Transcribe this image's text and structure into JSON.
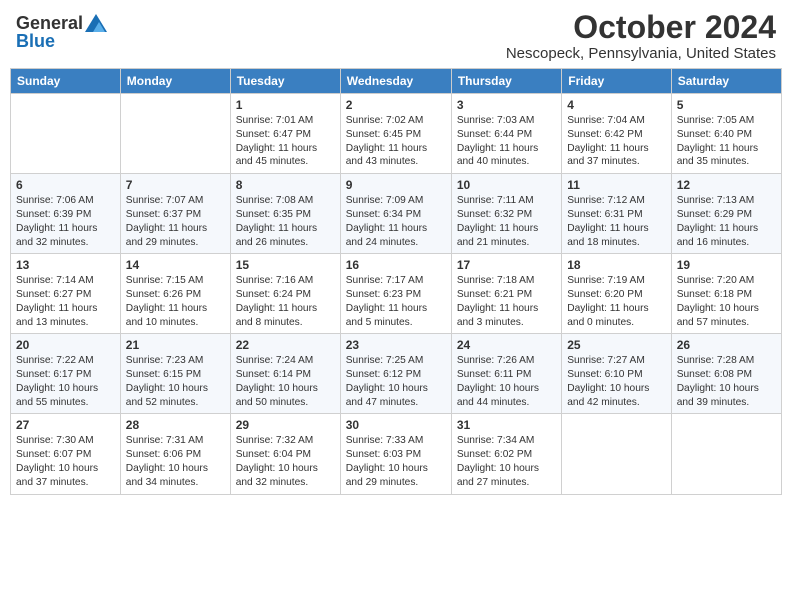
{
  "header": {
    "logo_general": "General",
    "logo_blue": "Blue",
    "title": "October 2024",
    "subtitle": "Nescopeck, Pennsylvania, United States"
  },
  "days_of_week": [
    "Sunday",
    "Monday",
    "Tuesday",
    "Wednesday",
    "Thursday",
    "Friday",
    "Saturday"
  ],
  "weeks": [
    [
      {
        "day": "",
        "content": ""
      },
      {
        "day": "",
        "content": ""
      },
      {
        "day": "1",
        "content": "Sunrise: 7:01 AM\nSunset: 6:47 PM\nDaylight: 11 hours and 45 minutes."
      },
      {
        "day": "2",
        "content": "Sunrise: 7:02 AM\nSunset: 6:45 PM\nDaylight: 11 hours and 43 minutes."
      },
      {
        "day": "3",
        "content": "Sunrise: 7:03 AM\nSunset: 6:44 PM\nDaylight: 11 hours and 40 minutes."
      },
      {
        "day": "4",
        "content": "Sunrise: 7:04 AM\nSunset: 6:42 PM\nDaylight: 11 hours and 37 minutes."
      },
      {
        "day": "5",
        "content": "Sunrise: 7:05 AM\nSunset: 6:40 PM\nDaylight: 11 hours and 35 minutes."
      }
    ],
    [
      {
        "day": "6",
        "content": "Sunrise: 7:06 AM\nSunset: 6:39 PM\nDaylight: 11 hours and 32 minutes."
      },
      {
        "day": "7",
        "content": "Sunrise: 7:07 AM\nSunset: 6:37 PM\nDaylight: 11 hours and 29 minutes."
      },
      {
        "day": "8",
        "content": "Sunrise: 7:08 AM\nSunset: 6:35 PM\nDaylight: 11 hours and 26 minutes."
      },
      {
        "day": "9",
        "content": "Sunrise: 7:09 AM\nSunset: 6:34 PM\nDaylight: 11 hours and 24 minutes."
      },
      {
        "day": "10",
        "content": "Sunrise: 7:11 AM\nSunset: 6:32 PM\nDaylight: 11 hours and 21 minutes."
      },
      {
        "day": "11",
        "content": "Sunrise: 7:12 AM\nSunset: 6:31 PM\nDaylight: 11 hours and 18 minutes."
      },
      {
        "day": "12",
        "content": "Sunrise: 7:13 AM\nSunset: 6:29 PM\nDaylight: 11 hours and 16 minutes."
      }
    ],
    [
      {
        "day": "13",
        "content": "Sunrise: 7:14 AM\nSunset: 6:27 PM\nDaylight: 11 hours and 13 minutes."
      },
      {
        "day": "14",
        "content": "Sunrise: 7:15 AM\nSunset: 6:26 PM\nDaylight: 11 hours and 10 minutes."
      },
      {
        "day": "15",
        "content": "Sunrise: 7:16 AM\nSunset: 6:24 PM\nDaylight: 11 hours and 8 minutes."
      },
      {
        "day": "16",
        "content": "Sunrise: 7:17 AM\nSunset: 6:23 PM\nDaylight: 11 hours and 5 minutes."
      },
      {
        "day": "17",
        "content": "Sunrise: 7:18 AM\nSunset: 6:21 PM\nDaylight: 11 hours and 3 minutes."
      },
      {
        "day": "18",
        "content": "Sunrise: 7:19 AM\nSunset: 6:20 PM\nDaylight: 11 hours and 0 minutes."
      },
      {
        "day": "19",
        "content": "Sunrise: 7:20 AM\nSunset: 6:18 PM\nDaylight: 10 hours and 57 minutes."
      }
    ],
    [
      {
        "day": "20",
        "content": "Sunrise: 7:22 AM\nSunset: 6:17 PM\nDaylight: 10 hours and 55 minutes."
      },
      {
        "day": "21",
        "content": "Sunrise: 7:23 AM\nSunset: 6:15 PM\nDaylight: 10 hours and 52 minutes."
      },
      {
        "day": "22",
        "content": "Sunrise: 7:24 AM\nSunset: 6:14 PM\nDaylight: 10 hours and 50 minutes."
      },
      {
        "day": "23",
        "content": "Sunrise: 7:25 AM\nSunset: 6:12 PM\nDaylight: 10 hours and 47 minutes."
      },
      {
        "day": "24",
        "content": "Sunrise: 7:26 AM\nSunset: 6:11 PM\nDaylight: 10 hours and 44 minutes."
      },
      {
        "day": "25",
        "content": "Sunrise: 7:27 AM\nSunset: 6:10 PM\nDaylight: 10 hours and 42 minutes."
      },
      {
        "day": "26",
        "content": "Sunrise: 7:28 AM\nSunset: 6:08 PM\nDaylight: 10 hours and 39 minutes."
      }
    ],
    [
      {
        "day": "27",
        "content": "Sunrise: 7:30 AM\nSunset: 6:07 PM\nDaylight: 10 hours and 37 minutes."
      },
      {
        "day": "28",
        "content": "Sunrise: 7:31 AM\nSunset: 6:06 PM\nDaylight: 10 hours and 34 minutes."
      },
      {
        "day": "29",
        "content": "Sunrise: 7:32 AM\nSunset: 6:04 PM\nDaylight: 10 hours and 32 minutes."
      },
      {
        "day": "30",
        "content": "Sunrise: 7:33 AM\nSunset: 6:03 PM\nDaylight: 10 hours and 29 minutes."
      },
      {
        "day": "31",
        "content": "Sunrise: 7:34 AM\nSunset: 6:02 PM\nDaylight: 10 hours and 27 minutes."
      },
      {
        "day": "",
        "content": ""
      },
      {
        "day": "",
        "content": ""
      }
    ]
  ]
}
